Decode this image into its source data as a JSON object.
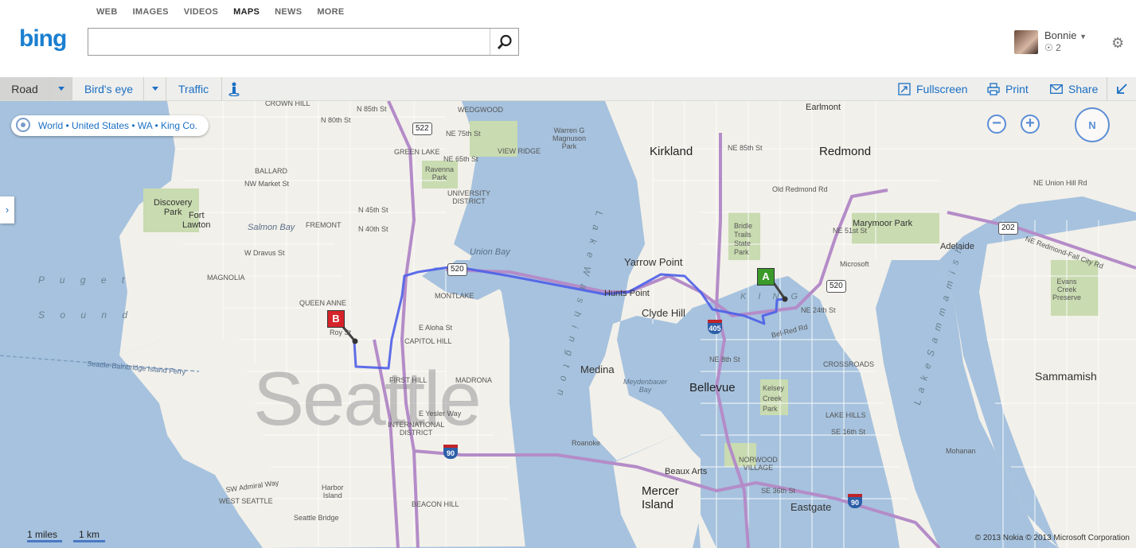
{
  "header": {
    "nav": [
      "WEB",
      "IMAGES",
      "VIDEOS",
      "MAPS",
      "NEWS",
      "MORE"
    ],
    "active_nav": "MAPS",
    "logo": "bing",
    "search": {
      "value": "",
      "placeholder": ""
    },
    "user": {
      "name": "Bonnie",
      "rewards": "2"
    }
  },
  "toolbar": {
    "road": "Road",
    "birds_eye": "Bird's eye",
    "traffic": "Traffic",
    "fullscreen": "Fullscreen",
    "print": "Print",
    "share": "Share"
  },
  "map": {
    "breadcrumb": "World • United States • WA • King Co.",
    "compass": "N",
    "zoom_out": "−",
    "zoom_in": "+",
    "pin_a": "A",
    "pin_b": "B",
    "watermark": "Seattle",
    "scale_miles": "1 miles",
    "scale_km": "1 km",
    "copyright": "© 2013 Nokia   © 2013 Microsoft Corporation",
    "cities": {
      "kirkland": "Kirkland",
      "redmond": "Redmond",
      "bellevue": "Bellevue",
      "medina": "Medina",
      "clyde_hill": "Clyde Hill",
      "yarrow_point": "Yarrow Point",
      "hunts_point": "Hunts Point",
      "mercer_island": "Mercer\nIsland",
      "sammamish": "Sammamish",
      "eastgate": "Eastgate"
    },
    "places": {
      "crown_hill": "CROWN HILL",
      "wedgwood": "WEDGWOOD",
      "earlmont": "Earlmont",
      "n85": "N 85th St",
      "n80": "N 80th St",
      "ne75": "NE 75th St",
      "ne65": "NE 65th St",
      "ne85": "NE 85th St",
      "warren": "Warren G\nMagnuson\nPark",
      "view_ridge": "VIEW RIDGE",
      "green_lake": "GREEN LAKE",
      "ravenna": "Ravenna\nPark",
      "univ": "UNIVERSITY\nDISTRICT",
      "ballard": "BALLARD",
      "nw_market": "NW Market St",
      "discovery": "Discovery\nPark",
      "fort_lawton": "Fort\nLawton",
      "fremont": "FREMONT",
      "salmon_bay": "Salmon Bay",
      "n45": "N 45th St",
      "n40": "N 40th St",
      "w_dravus": "W Dravus St",
      "magnolia": "MAGNOLIA",
      "union_bay": "Union Bay",
      "montlake": "MONTLAKE",
      "queen_anne": "QUEEN ANNE",
      "roy_st": "Roy St",
      "e_aloha": "E Aloha St",
      "capitol_hill": "CAPITOL HILL",
      "first_hill": "FIRST HILL",
      "madrona": "MADRONA",
      "e_yesler": "E Yesler Way",
      "intl": "INTERNATIONAL\nDISTRICT",
      "old_redmond": "Old Redmond Rd",
      "bridle": "Bridle\nTrails\nState\nPark",
      "marymoor": "Marymoor Park",
      "ne_union_hill": "NE Union Hill Rd",
      "ne51": "NE 51st St",
      "microsoft": "Microsoft",
      "adelaide": "Adelaide",
      "ne_redmond_fall": "NE Redmond-Fall City Rd",
      "evans": "Evans\nCreek\nPreserve",
      "ne24": "NE 24th St",
      "bel_red": "Bel-Red Rd",
      "crossroads": "CROSSROADS",
      "ne8": "NE 8th St",
      "kelsey": "Kelsey\nCreek\nPark",
      "lake_hills": "LAKE HILLS",
      "se16": "SE 16th St",
      "meydenbauer": "Meydenbauer\nBay",
      "roanoke": "Roanoke",
      "beaux_arts": "Beaux Arts",
      "norwood": "NORWOOD\nVILLAGE",
      "se36": "SE 36th St",
      "mohanan": "Mohanan",
      "beacon_hill": "BEACON HILL",
      "harbor_island": "Harbor\nIsland",
      "west_seattle": "WEST SEATTLE",
      "seattle_bridge": "Seattle Bridge",
      "sw_admiral": "SW Admiral Way",
      "ferry": "Seattle-Bainbridge Island Ferry",
      "puget": "P u g e t",
      "sound": "S o u n d",
      "lake_wash": "L a k e   W a s h i n g t o n",
      "lake_samm": "L a k e   S a m m a m i s h",
      "king": "K I N G"
    },
    "shields": {
      "r522": "522",
      "r520a": "520",
      "r520b": "520",
      "r202": "202",
      "r405": "405",
      "r90a": "90",
      "r90b": "90"
    },
    "colors": {
      "water": "#a6c2de",
      "land": "#f2f0ea",
      "park": "#c9dbb0",
      "highway": "#b48cc8",
      "route": "#4d5fe8",
      "toolbar_link": "#1a6fc4"
    }
  }
}
